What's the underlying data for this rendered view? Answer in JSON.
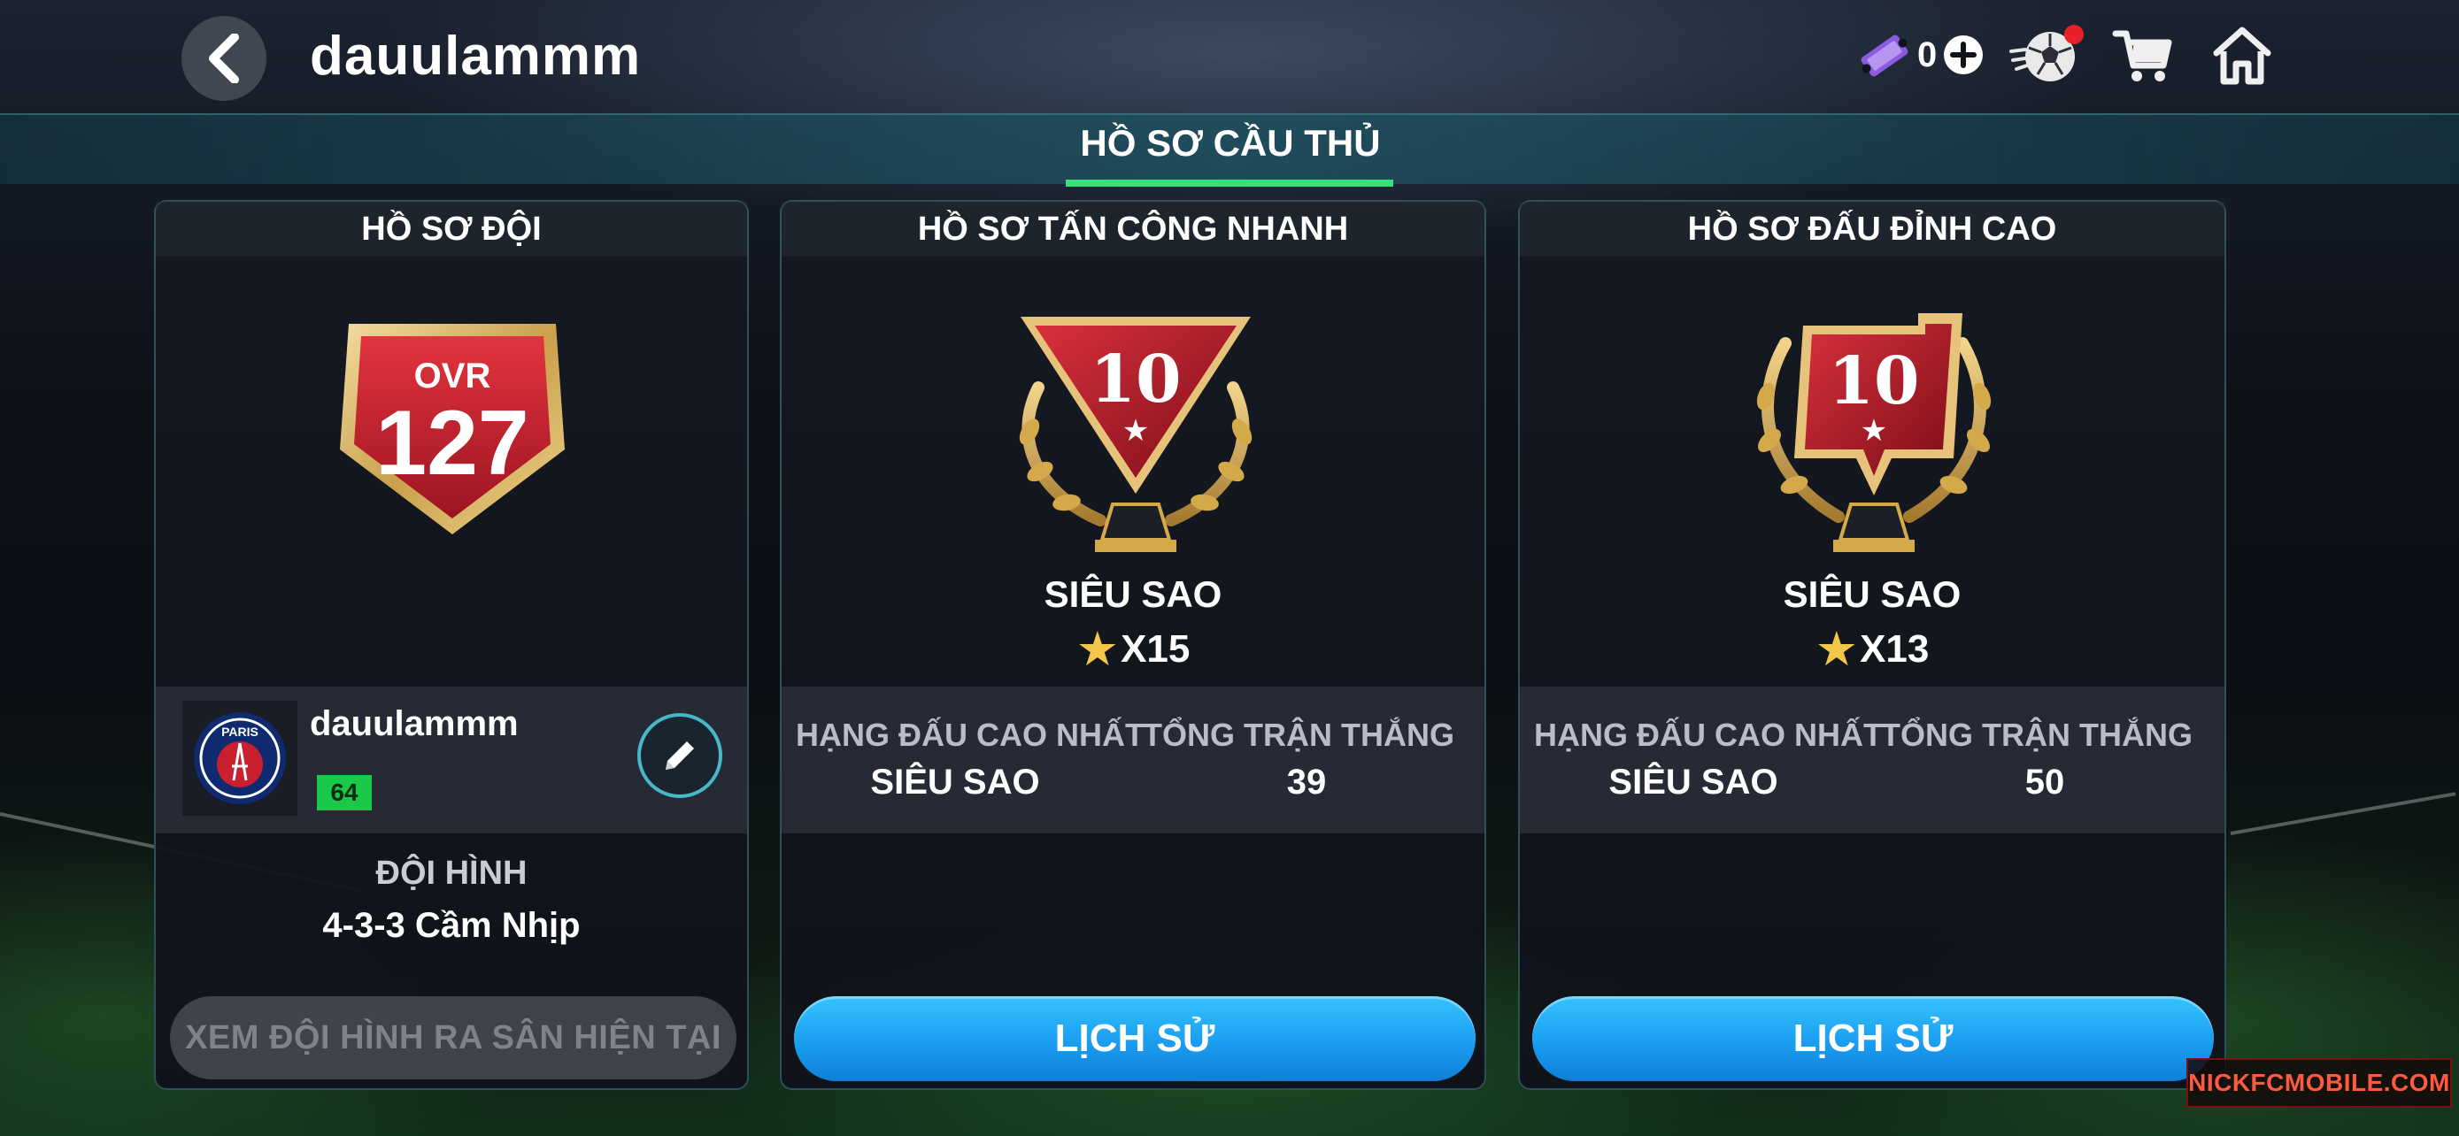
{
  "header": {
    "username": "dauulammm",
    "ticket_count": "0"
  },
  "section": {
    "title": "HỒ SƠ CẦU THỦ"
  },
  "team_profile": {
    "title": "HỒ SƠ ĐỘI",
    "ovr_label": "OVR",
    "ovr_value": "127",
    "club_name": "dauulammm",
    "club_rating": "64",
    "formation_label": "ĐỘI HÌNH",
    "formation_value": "4-3-3 Cầm Nhịp",
    "view_lineup_label": "XEM ĐỘI HÌNH RA SÂN HIỆN TẠI"
  },
  "fast_attack": {
    "title": "HỒ SƠ TẤN CÔNG NHANH",
    "trophy_number": "10",
    "rank": "SIÊU SAO",
    "stars": "X15",
    "highest_league_label": "HẠNG ĐẤU CAO NHẤT",
    "highest_league_value": "SIÊU SAO",
    "total_wins_label": "TỔNG TRẬN THẮNG",
    "total_wins_value": "39",
    "history_label": "LỊCH SỬ"
  },
  "top_match": {
    "title": "HỒ SƠ ĐẤU ĐỈNH CAO",
    "trophy_number": "10",
    "rank": "SIÊU SAO",
    "stars": "X13",
    "highest_league_label": "HẠNG ĐẤU CAO NHẤT",
    "highest_league_value": "SIÊU SAO",
    "total_wins_label": "TỔNG TRẬN THẮNG",
    "total_wins_value": "50",
    "history_label": "LỊCH SỬ"
  },
  "watermark": "NICKFCMOBILE.COM",
  "colors": {
    "accent_green": "#35e07b",
    "button_blue": "#1a9df0",
    "badge_red": "#c8202e",
    "gold": "#d4a94a"
  }
}
